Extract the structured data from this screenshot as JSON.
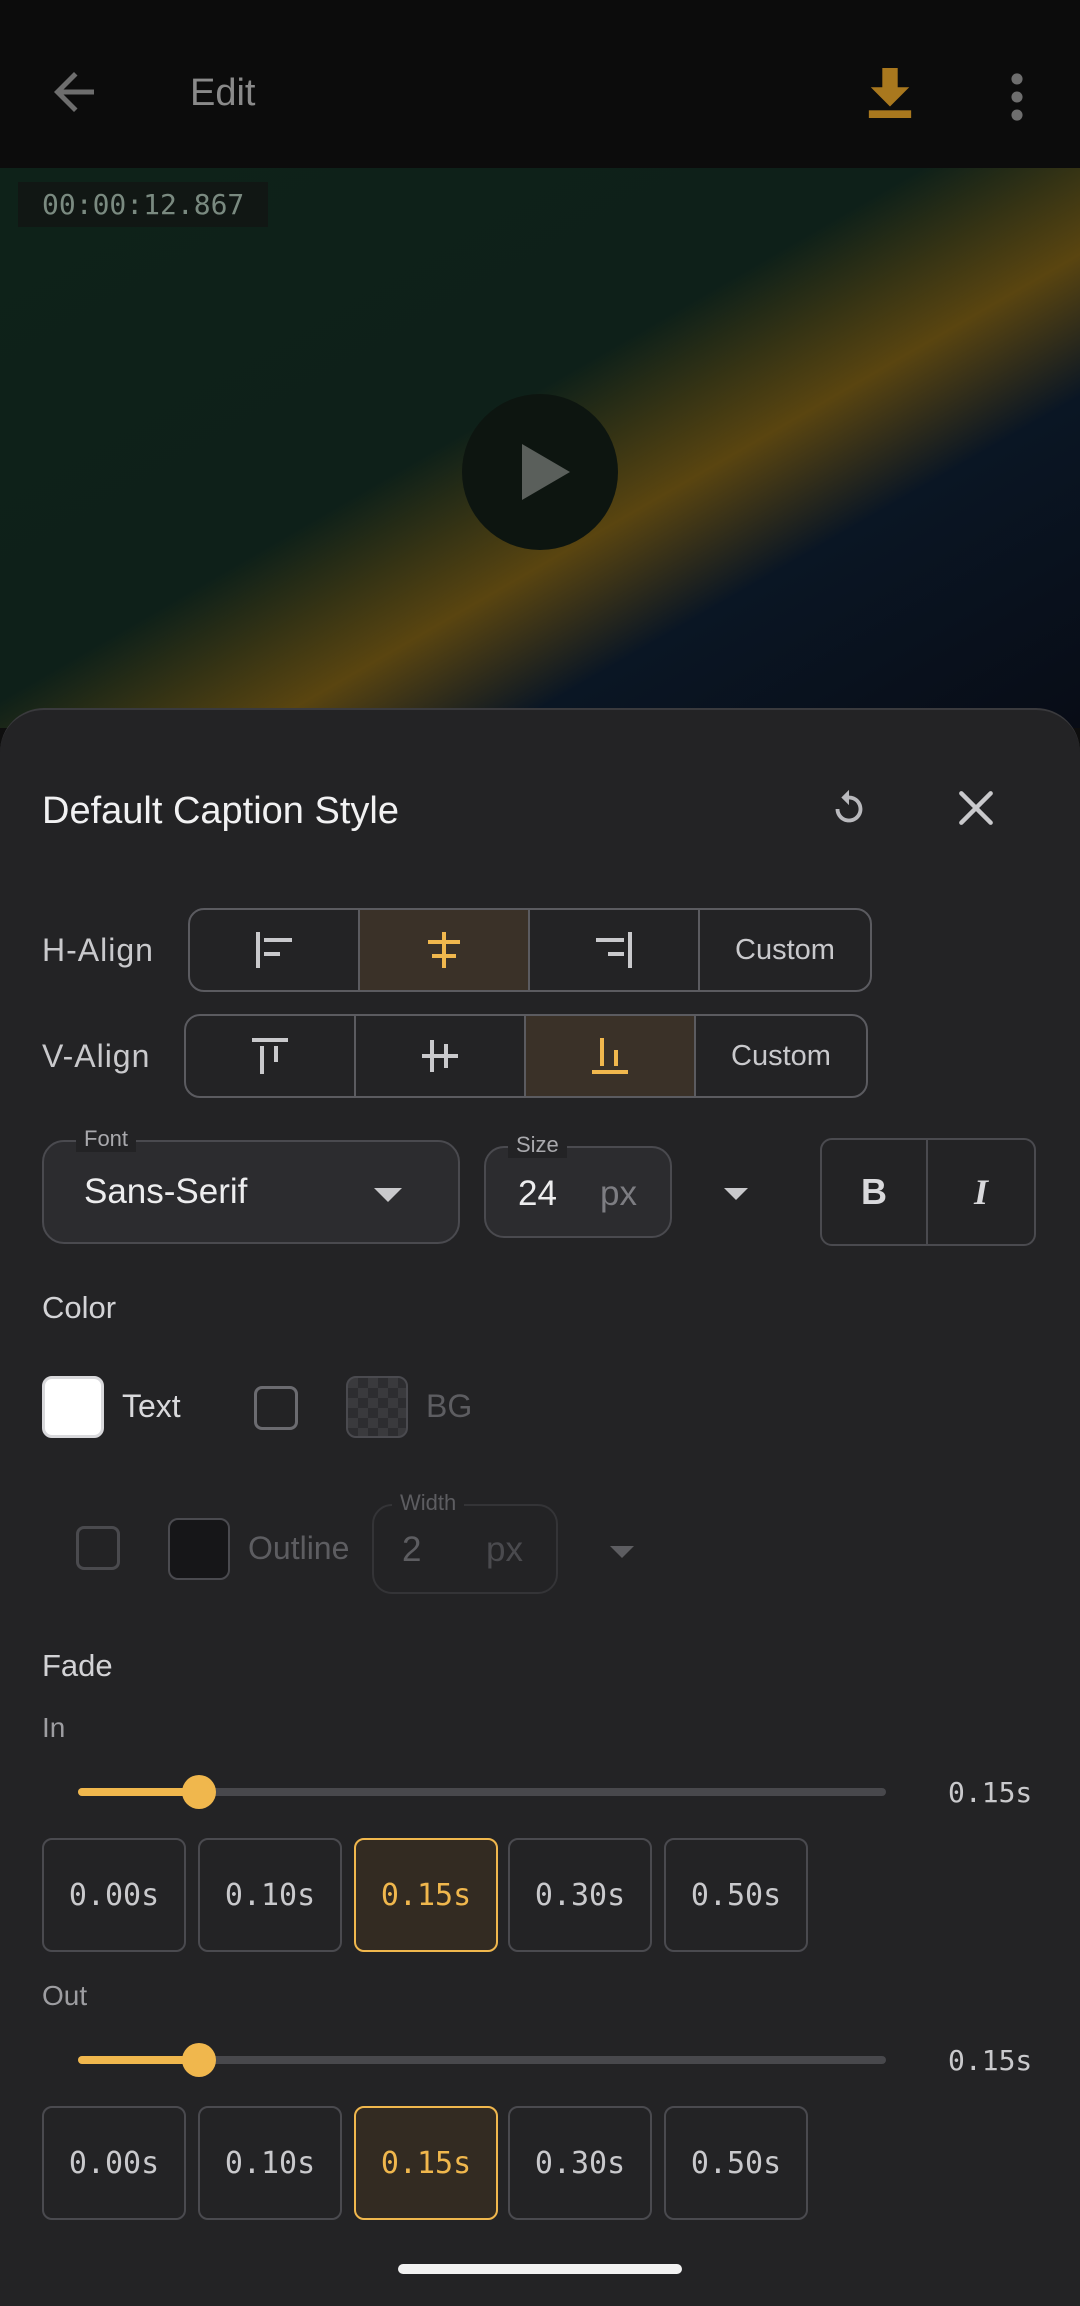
{
  "topbar": {
    "title": "Edit",
    "icons": [
      "back-arrow-icon",
      "download-icon",
      "more-vert-icon"
    ]
  },
  "video": {
    "timestamp": "00:00:12.867"
  },
  "sheet": {
    "title": "Default Caption Style",
    "h_align": {
      "label": "H-Align",
      "options": [
        "align-left",
        "align-center",
        "align-right",
        "Custom"
      ],
      "custom_label": "Custom",
      "selected": "align-center"
    },
    "v_align": {
      "label": "V-Align",
      "options": [
        "align-top",
        "align-middle",
        "align-bottom",
        "Custom"
      ],
      "custom_label": "Custom",
      "selected": "align-bottom"
    },
    "font": {
      "label": "Font",
      "value": "Sans-Serif"
    },
    "size": {
      "label": "Size",
      "value": "24",
      "unit": "px"
    },
    "style": {
      "bold": "B",
      "italic": "I"
    },
    "color": {
      "section": "Color",
      "text_label": "Text",
      "bg_label": "BG",
      "outline_label": "Outline",
      "width_label": "Width",
      "width_value": "2",
      "width_unit": "px"
    },
    "fade": {
      "section": "Fade",
      "in": {
        "label": "In",
        "value_text": "0.15s",
        "value": 0.15,
        "max": 1.0,
        "presets": [
          "0.00s",
          "0.10s",
          "0.15s",
          "0.30s",
          "0.50s"
        ],
        "selected": "0.15s"
      },
      "out": {
        "label": "Out",
        "value_text": "0.15s",
        "value": 0.15,
        "max": 1.0,
        "presets": [
          "0.00s",
          "0.10s",
          "0.15s",
          "0.30s",
          "0.50s"
        ],
        "selected": "0.15s"
      }
    }
  },
  "colors": {
    "accent": "#f0b74d",
    "sheet_bg": "#232325"
  }
}
